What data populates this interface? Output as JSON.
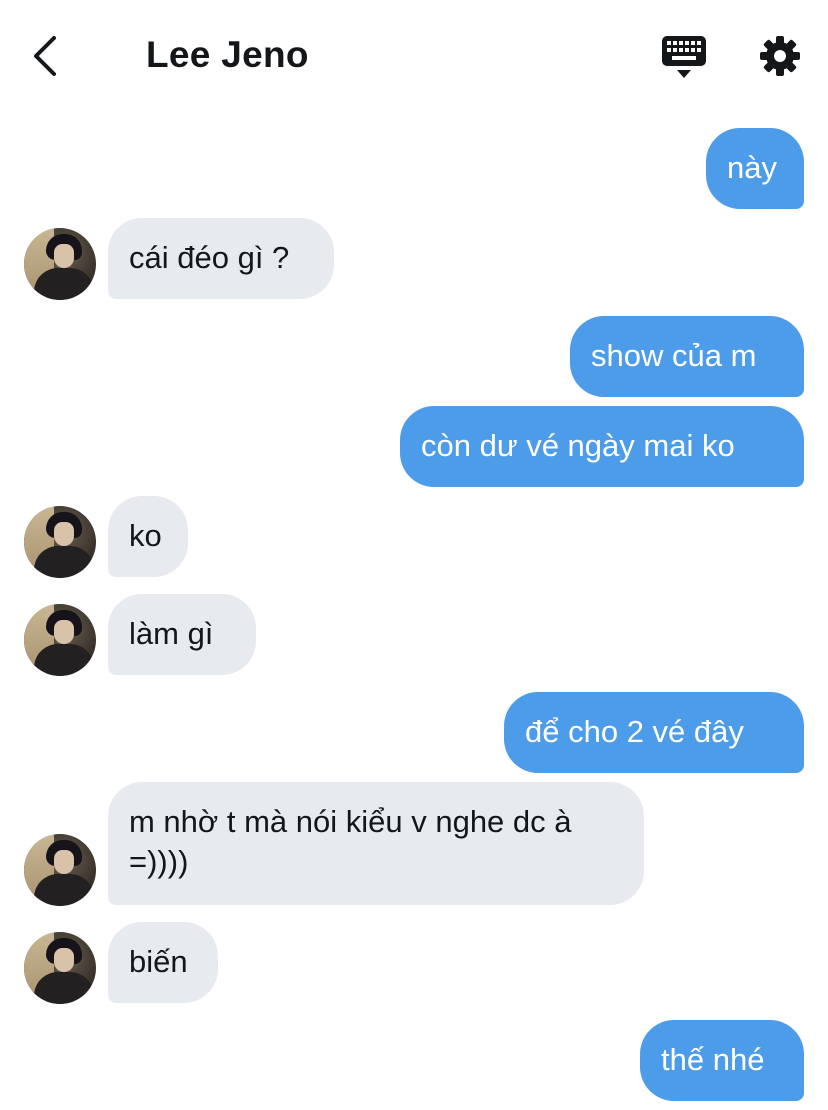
{
  "header": {
    "title": "Lee Jeno",
    "back_icon": "chevron-left-icon",
    "keyboard_icon": "keyboard-icon",
    "settings_icon": "gear-icon"
  },
  "colors": {
    "outgoing_bubble": "#4c9cea",
    "incoming_bubble": "#e7ebf0",
    "text_dark": "#14171a"
  },
  "messages": [
    {
      "dir": "out",
      "text": "này"
    },
    {
      "dir": "in",
      "text": "cái đéo gì ?"
    },
    {
      "dir": "out",
      "text": "show của m"
    },
    {
      "dir": "out",
      "text": "còn dư vé ngày mai ko"
    },
    {
      "dir": "in",
      "text": "ko"
    },
    {
      "dir": "in",
      "text": "làm gì"
    },
    {
      "dir": "out",
      "text": "để cho 2 vé đây"
    },
    {
      "dir": "in",
      "text": "m nhờ t mà nói kiểu v nghe dc à =))))"
    },
    {
      "dir": "in",
      "text": "biến"
    },
    {
      "dir": "out",
      "text": "thế nhé"
    }
  ]
}
